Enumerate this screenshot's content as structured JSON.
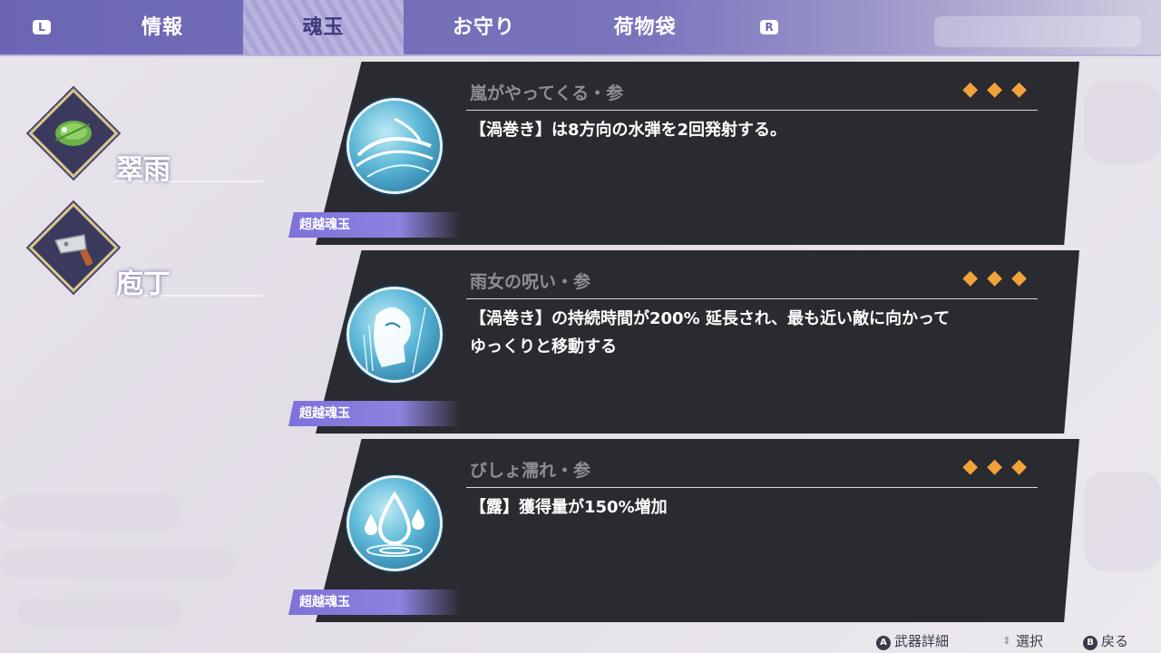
{
  "top_tabs": {
    "left_shoulder": "L",
    "right_shoulder": "R",
    "tabs": [
      "情報",
      "魂玉",
      "お守り",
      "荷物袋"
    ],
    "active_index": 1
  },
  "weapons": [
    {
      "name": "翠雨",
      "icon": "leaf-frog-icon"
    },
    {
      "name": "庖丁",
      "icon": "cleaver-icon"
    }
  ],
  "soul_gems": [
    {
      "name": "嵐がやってくる・参",
      "rarity": 3,
      "gems": "◆◆◆",
      "description": "【渦巻き】は8方向の水弾を2回発射する。",
      "tag": "超越魂玉",
      "icon": "whirlwind-water-icon"
    },
    {
      "name": "雨女の呪い・参",
      "rarity": 3,
      "gems": "◆◆◆",
      "description": "【渦巻き】の持続時間が200% 延長され、最も近い敵に向かって\nゆっくりと移動する",
      "tag": "超越魂玉",
      "icon": "rain-woman-icon"
    },
    {
      "name": "びしょ濡れ・参",
      "rarity": 3,
      "gems": "◆◆◆",
      "description": "【露】獲得量が150%増加",
      "tag": "超越魂玉",
      "icon": "water-drops-icon"
    }
  ],
  "hints": [
    {
      "button": "A",
      "label": "武器詳細"
    },
    {
      "button": "⇕",
      "label": "選択"
    },
    {
      "button": "B",
      "label": "戻る"
    }
  ],
  "colors": {
    "tab_bar": "#6b66b4",
    "tag_purple": "#7d72d8",
    "gem_orange": "#f2a23a",
    "card_bg": "#2a2b30"
  }
}
